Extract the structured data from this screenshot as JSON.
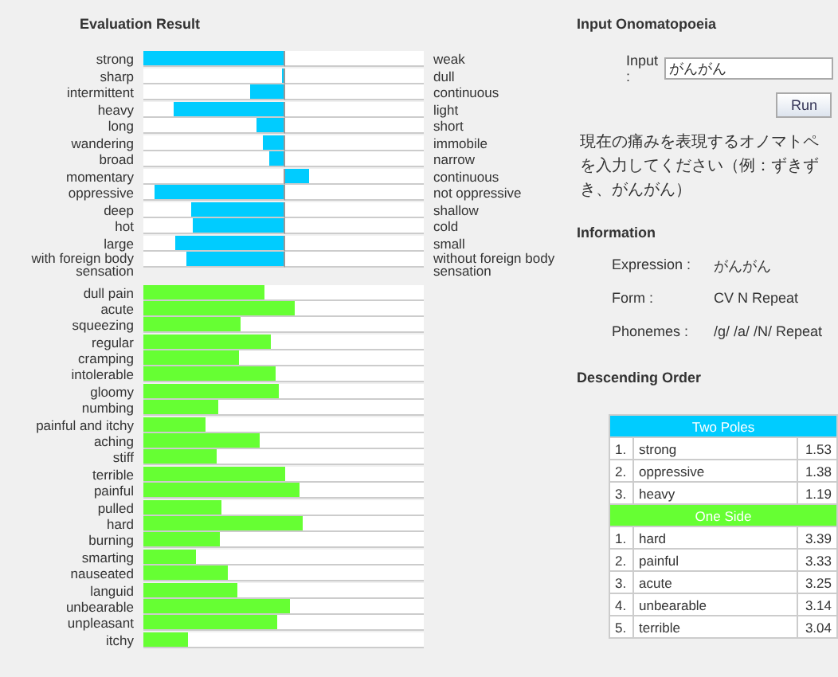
{
  "evaluation": {
    "title": "Evaluation Result",
    "two_poles": [
      {
        "left": {
          "label": "strong",
          "level": 1.0
        },
        "right": {
          "label": "weak"
        }
      },
      {
        "left": {
          "label": "sharp",
          "level": 0.01
        },
        "right": {
          "label": "dull"
        }
      },
      {
        "left": {
          "label": "intermittent",
          "level": 0.234
        },
        "right": {
          "label": "continuous"
        }
      },
      {
        "left": {
          "label": "heavy",
          "level": 0.78
        },
        "right": {
          "label": "light"
        }
      },
      {
        "left": {
          "label": "long",
          "level": 0.186
        },
        "right": {
          "label": "short"
        }
      },
      {
        "left": {
          "label": "wandering",
          "level": 0.142
        },
        "right": {
          "label": "immobile"
        }
      },
      {
        "left": {
          "label": "broad",
          "level": 0.094
        },
        "right": {
          "label": "narrow"
        }
      },
      {
        "left": {
          "label": "momentary"
        },
        "right": {
          "label": "continuous",
          "level": 0.172
        }
      },
      {
        "left": {
          "label": "oppressive",
          "level": 0.916
        },
        "right": {
          "label": "not oppressive"
        }
      },
      {
        "left": {
          "label": "deep",
          "level": 0.66
        },
        "right": {
          "label": "shallow"
        }
      },
      {
        "left": {
          "label": "hot",
          "level": 0.65
        },
        "right": {
          "label": "cold"
        }
      },
      {
        "left": {
          "label": "large",
          "level": 0.77
        },
        "right": {
          "label": "small"
        }
      },
      {
        "left": {
          "label": "with foreign body sensation",
          "level": 0.686
        },
        "right": {
          "label": "without foreign body sensation"
        }
      }
    ],
    "one_side": [
      {
        "label": "dull pain",
        "level": 0.434
      },
      {
        "label": "acute",
        "level": 0.54
      },
      {
        "label": "squeezing",
        "level": 0.349
      },
      {
        "label": "regular",
        "level": 0.453
      },
      {
        "label": "cramping",
        "level": 0.339
      },
      {
        "label": "intolerable",
        "level": 0.469
      },
      {
        "label": "gloomy",
        "level": 0.485
      },
      {
        "label": "numbing",
        "level": 0.268
      },
      {
        "label": "painful and itchy",
        "level": 0.221
      },
      {
        "label": "aching",
        "level": 0.412
      },
      {
        "label": "stiff",
        "level": 0.261
      },
      {
        "label": "terrible",
        "level": 0.504
      },
      {
        "label": "painful",
        "level": 0.557
      },
      {
        "label": "pulled",
        "level": 0.277
      },
      {
        "label": "hard",
        "level": 0.566
      },
      {
        "label": "burning",
        "level": 0.274
      },
      {
        "label": "smarting",
        "level": 0.188
      },
      {
        "label": "nauseated",
        "level": 0.303
      },
      {
        "label": "languid",
        "level": 0.334
      },
      {
        "label": "unbearable",
        "level": 0.522
      },
      {
        "label": "unpleasant",
        "level": 0.48
      },
      {
        "label": "itchy",
        "level": 0.157
      }
    ]
  },
  "input_panel": {
    "title": "Input Onomatopoeia",
    "label": "Input :",
    "value": "がんがん",
    "button": "Run",
    "hint": "現在の痛みを表現するオノマトペを入力してください（例：ずきずき、がんがん）"
  },
  "information": {
    "title": "Information",
    "fields": [
      {
        "label": "Expression :",
        "value": "がんがん"
      },
      {
        "label": "Form :",
        "value": "CV N Repeat"
      },
      {
        "label": "Phonemes :",
        "value": "/g/ /a/ /N/ Repeat"
      }
    ]
  },
  "descending_order": {
    "title": "Descending Order",
    "sections": [
      {
        "title": "Two Poles",
        "color": "#00ccff",
        "rows": [
          {
            "rank": "1.",
            "term": "strong",
            "score": "1.53"
          },
          {
            "rank": "2.",
            "term": "oppressive",
            "score": "1.38"
          },
          {
            "rank": "3.",
            "term": "heavy",
            "score": "1.19"
          }
        ]
      },
      {
        "title": "One Side",
        "color": "#66ff33",
        "rows": [
          {
            "rank": "1.",
            "term": "hard",
            "score": "3.39"
          },
          {
            "rank": "2.",
            "term": "painful",
            "score": "3.33"
          },
          {
            "rank": "3.",
            "term": "acute",
            "score": "3.25"
          },
          {
            "rank": "4.",
            "term": "unbearable",
            "score": "3.14"
          },
          {
            "rank": "5.",
            "term": "terrible",
            "score": "3.04"
          }
        ]
      }
    ]
  }
}
